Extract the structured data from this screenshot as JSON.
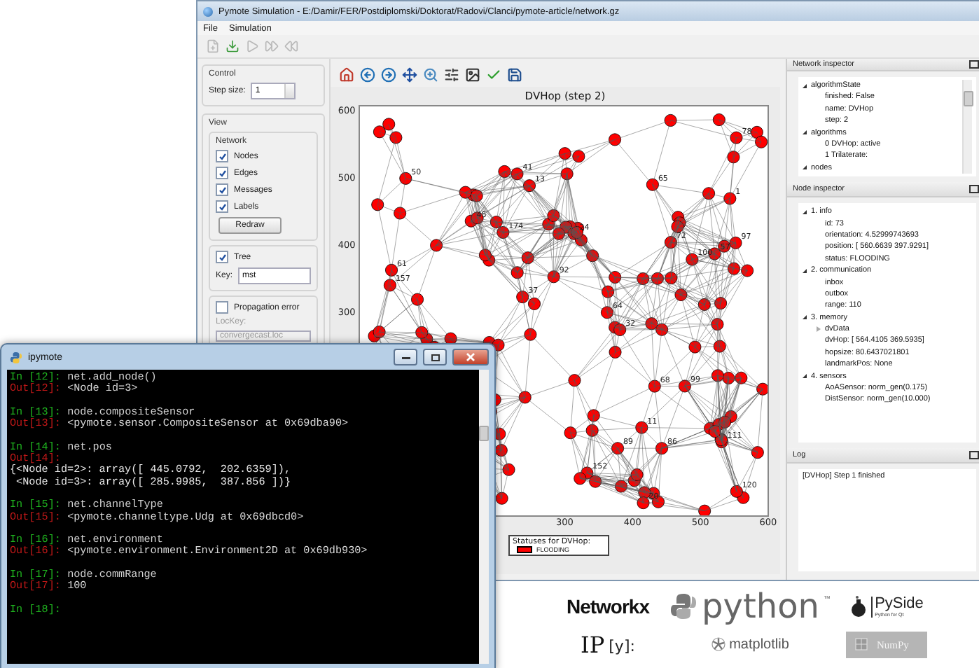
{
  "main_window": {
    "title": "Pymote Simulation - E:/Damir/FER/Postdiplomski/Doktorat/Radovi/Clanci/pymote-article/network.gz",
    "menu": [
      "File",
      "Simulation"
    ],
    "toolbar": [
      {
        "kind": "new",
        "disabled": true
      },
      {
        "kind": "load",
        "disabled": false
      },
      {
        "kind": "run",
        "disabled": true
      },
      {
        "kind": "step",
        "disabled": true
      },
      {
        "kind": "reset",
        "disabled": true
      }
    ]
  },
  "control": {
    "title": "Control",
    "step_label": "Step size:",
    "step_value": "1"
  },
  "view": {
    "title": "View",
    "network": {
      "title": "Network",
      "options": [
        {
          "label": "Nodes",
          "checked": true
        },
        {
          "label": "Edges",
          "checked": true
        },
        {
          "label": "Messages",
          "checked": true
        },
        {
          "label": "Labels",
          "checked": true
        }
      ],
      "button": "Redraw"
    },
    "tree": {
      "label": "Tree",
      "checked": true,
      "key_label": "Key:",
      "key_value": "mst"
    },
    "propagation": {
      "label": "Propagation error",
      "checked": false,
      "lockey_label": "LocKey:",
      "lockey_value": "convergecast.loc",
      "disabled": true
    }
  },
  "plot": {
    "toolbar": [
      {
        "kind": "home"
      },
      {
        "kind": "back"
      },
      {
        "kind": "forward"
      },
      {
        "kind": "pan"
      },
      {
        "kind": "zoom"
      },
      {
        "kind": "configure"
      },
      {
        "kind": "save-figure"
      },
      {
        "kind": "check"
      },
      {
        "kind": "save"
      }
    ],
    "title": "DVHop (step 2)",
    "yticks": [
      "600",
      "500",
      "400",
      "300"
    ],
    "xticks": [
      "300",
      "400",
      "500",
      "600"
    ],
    "node_labels": [
      "50",
      "1",
      "78",
      "120",
      "64",
      "157",
      "152",
      "111",
      "11",
      "32",
      "97",
      "174",
      "100",
      "72",
      "45",
      "68",
      "57",
      "99",
      "89",
      "24",
      "61",
      "65",
      "86",
      "41",
      "37",
      "20",
      "13",
      "92"
    ],
    "legend": {
      "title": "Statuses for DVHop:",
      "items": [
        {
          "label": "FLOODING",
          "color": "#ff0000"
        }
      ]
    }
  },
  "network_inspector": {
    "title": "Network inspector",
    "tree": [
      {
        "label": "algorithmState",
        "expanded": true,
        "children": [
          {
            "label": "finished: False"
          },
          {
            "label": "name: DVHop"
          },
          {
            "label": "step: 2"
          }
        ]
      },
      {
        "label": "algorithms",
        "expanded": true,
        "children": [
          {
            "label": "0 DVHop: active"
          },
          {
            "label": "1 Trilaterate:"
          }
        ]
      },
      {
        "label": "nodes",
        "expanded": true
      }
    ]
  },
  "node_inspector": {
    "title": "Node inspector",
    "tree": [
      {
        "label": "1. info",
        "expanded": true,
        "children": [
          {
            "label": "id: 73"
          },
          {
            "label": "orientation: 4.52999743693"
          },
          {
            "label": "position: [ 560.6639  397.9291]"
          },
          {
            "label": "status: FLOODING"
          }
        ]
      },
      {
        "label": "2. communication",
        "expanded": true,
        "children": [
          {
            "label": "inbox"
          },
          {
            "label": "outbox"
          },
          {
            "label": "range: 110"
          }
        ]
      },
      {
        "label": "3. memory",
        "expanded": true,
        "children": [
          {
            "label": "dvData",
            "expanded": false
          },
          {
            "label": "dvHop: [ 564.4105  369.5935]"
          },
          {
            "label": "hopsize: 80.6437021801"
          },
          {
            "label": "landmarkPos: None"
          }
        ]
      },
      {
        "label": "4. sensors",
        "expanded": true,
        "children": [
          {
            "label": "AoASensor: norm_gen(0.175)"
          },
          {
            "label": "DistSensor: norm_gen(10.000)"
          }
        ]
      }
    ]
  },
  "log": {
    "title": "Log",
    "lines": [
      "[DVHop] Step 1 finished"
    ]
  },
  "console": {
    "title": "ipymote",
    "cells": [
      [
        {
          "kind": "in",
          "prompt": "In [12]:",
          "code": "net.add_node()"
        },
        {
          "kind": "out",
          "prompt": "Out[12]:",
          "code": "<Node id=3>"
        }
      ],
      [
        {
          "kind": "in",
          "prompt": "In [13]:",
          "code": "node.compositeSensor"
        },
        {
          "kind": "out",
          "prompt": "Out[13]:",
          "code": "<pymote.sensor.CompositeSensor at 0x69dba90>"
        }
      ],
      [
        {
          "kind": "in",
          "prompt": "In [14]:",
          "code": "net.pos"
        },
        {
          "kind": "out",
          "prompt": "Out[14]:"
        },
        {
          "kind": "text",
          "code": "{<Node id=2>: array([ 445.0792,  202.6359]),"
        },
        {
          "kind": "text",
          "code": " <Node id=3>: array([ 285.9985,  387.856 ])}"
        }
      ],
      [
        {
          "kind": "in",
          "prompt": "In [15]:",
          "code": "net.channelType"
        },
        {
          "kind": "out",
          "prompt": "Out[15]:",
          "code": "<pymote.channeltype.Udg at 0x69dbcd0>"
        }
      ],
      [
        {
          "kind": "in",
          "prompt": "In [16]:",
          "code": "net.environment"
        },
        {
          "kind": "out",
          "prompt": "Out[16]:",
          "code": "<pymote.environment.Environment2D at 0x69db930>"
        }
      ],
      [
        {
          "kind": "in",
          "prompt": "In [17]:",
          "code": "node.commRange"
        },
        {
          "kind": "out",
          "prompt": "Out[17]:",
          "code": "100"
        }
      ],
      [
        {
          "kind": "in",
          "prompt": "In [18]:"
        }
      ]
    ]
  },
  "logos": [
    {
      "kind": "networkx",
      "text": "Networkx"
    },
    {
      "kind": "python",
      "text": "python",
      "mark": "™"
    },
    {
      "kind": "pyside",
      "text": "PySide",
      "tagline": "Python for Qt"
    },
    {
      "kind": "ipython",
      "text": "IP",
      "suffix": "[y]:"
    },
    {
      "kind": "matplotlib",
      "text": "matplotlib"
    },
    {
      "kind": "numpy",
      "text": "NumPy"
    }
  ]
}
